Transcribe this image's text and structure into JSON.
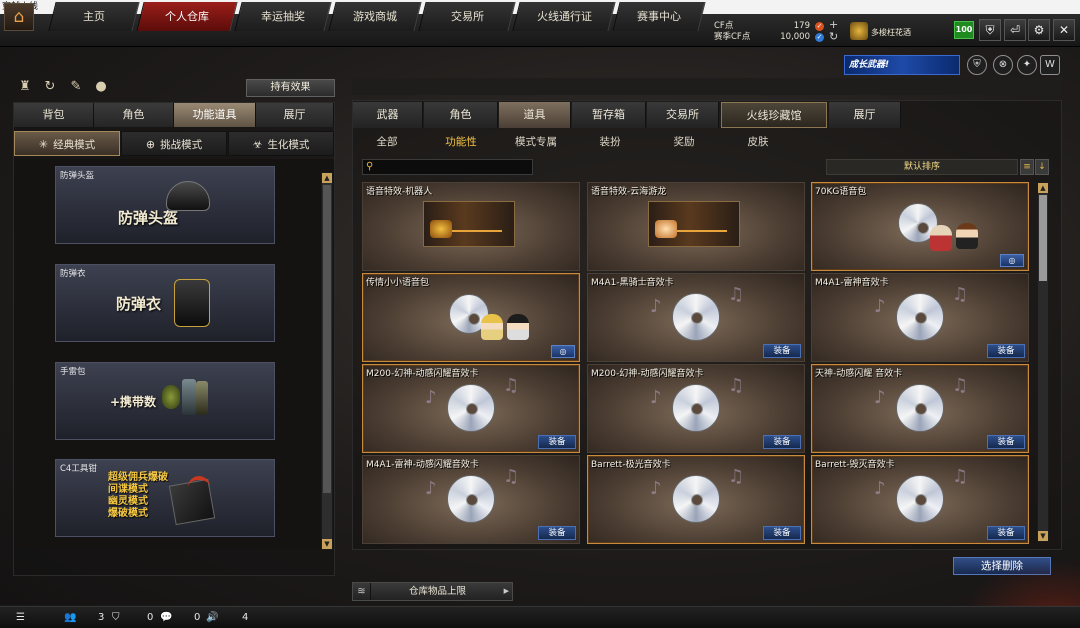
{
  "window": {
    "title": "穿越火线"
  },
  "topnav": {
    "tabs": [
      "主页",
      "个人仓库",
      "幸运抽奖",
      "游戏商城",
      "交易所",
      "火线通行证",
      "赛事中心"
    ],
    "active_index": 1
  },
  "currency": {
    "cf_label": "CF点",
    "cf_value": "179",
    "season_label": "赛季CF点",
    "season_value": "10,000"
  },
  "player": {
    "name": "多梭枉花酒",
    "level": "100"
  },
  "left": {
    "holding_effect_label": "持有效果",
    "tabs": [
      "背包",
      "角色",
      "功能道具",
      "展厅"
    ],
    "active_tab": 2,
    "modes": [
      {
        "icon": "star-burst-icon",
        "label": "经典模式"
      },
      {
        "icon": "target-icon",
        "label": "挑战模式"
      },
      {
        "icon": "biohazard-icon",
        "label": "生化模式"
      }
    ],
    "items": [
      {
        "name": "防弹头盔",
        "art_text": "防弹头盔"
      },
      {
        "name": "防弹衣",
        "art_text": "防弹衣"
      },
      {
        "name": "手雷包",
        "art_text": "+携带数"
      },
      {
        "name": "C4工具钳",
        "art_lines": [
          "超级佣兵爆破",
          "间谍模式",
          "幽灵模式",
          "爆破模式"
        ]
      }
    ]
  },
  "right": {
    "promo_text": "成长武器!",
    "tabs": [
      "武器",
      "角色",
      "道具",
      "暂存箱",
      "交易所",
      "火线珍藏馆",
      "展厅"
    ],
    "active_tab": 2,
    "subtabs": [
      "全部",
      "功能性",
      "模式专属",
      "装扮",
      "奖励",
      "皮肤"
    ],
    "active_subtab": 1,
    "search_placeholder": "",
    "sort_label": "默认排序",
    "items": [
      {
        "name": "语音特效-机器人",
        "art": "banner-robot",
        "action": ""
      },
      {
        "name": "语音特效-云海游龙",
        "art": "banner-dragon",
        "action": ""
      },
      {
        "name": "70KG语音包",
        "art": "voice-pack",
        "action": "info"
      },
      {
        "name": "传情小小语音包",
        "art": "voice-pack",
        "action": "info"
      },
      {
        "name": "M4A1-黑骑士音效卡",
        "art": "disc",
        "action": "装备"
      },
      {
        "name": "M4A1-雷神音效卡",
        "art": "disc",
        "action": "装备"
      },
      {
        "name": "M200-幻神-动感闪耀音效卡",
        "art": "disc",
        "action": "装备"
      },
      {
        "name": "M200-幻神-动感闪耀音效卡",
        "art": "disc",
        "action": "装备"
      },
      {
        "name": "天神-动感闪耀 音效卡",
        "art": "disc",
        "action": "装备"
      },
      {
        "name": "M4A1-雷神-动感闪耀音效卡",
        "art": "disc",
        "action": "装备"
      },
      {
        "name": "Barrett-极光音效卡",
        "art": "disc",
        "action": "装备"
      },
      {
        "name": "Barrett-毁灭音效卡",
        "art": "disc",
        "action": "装备"
      }
    ],
    "delete_label": "选择删除",
    "capacity_label": "仓库物品上限"
  },
  "bottombar": {
    "friends_count": "3",
    "shield_count": "0",
    "chat_count": "0",
    "voice_count": "4"
  },
  "colors": {
    "accent_red": "#9b1f1a",
    "gold": "#f5c342",
    "equip_blue": "#2d4e8a"
  }
}
